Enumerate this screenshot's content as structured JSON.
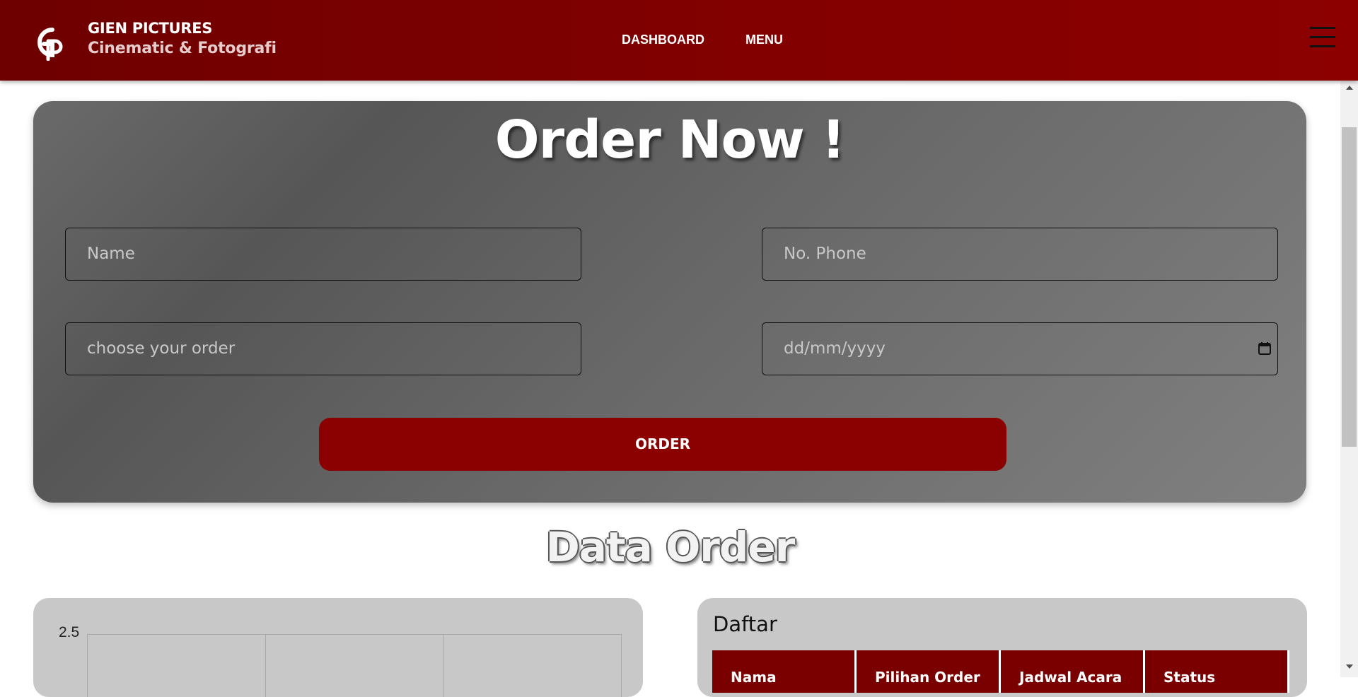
{
  "brand": {
    "name": "GIEN PICTURES",
    "tagline": "Cinematic & Fotografi",
    "logo_icon": "gp-monogram-logo"
  },
  "nav": {
    "items": [
      {
        "label": "DASHBOARD"
      },
      {
        "label": "MENU"
      }
    ],
    "menu_icon": "hamburger-icon"
  },
  "order_form": {
    "title": "Order Now !",
    "name_placeholder": "Name",
    "phone_placeholder": "No. Phone",
    "order_placeholder": "choose your order",
    "date_placeholder": "dd/mm/yyyy",
    "submit_label": "ORDER"
  },
  "data_section": {
    "title": "Data Order"
  },
  "chart": {
    "top_tick": "2.5"
  },
  "list": {
    "title": "Daftar",
    "columns": [
      "Nama",
      "Pilihan Order",
      "Jadwal Acara",
      "Status"
    ]
  },
  "colors": {
    "navbar": "#820000",
    "button": "#8b0000",
    "table_header": "#7a0000",
    "panel": "#6a6a6a",
    "card": "#c8c8c8"
  }
}
